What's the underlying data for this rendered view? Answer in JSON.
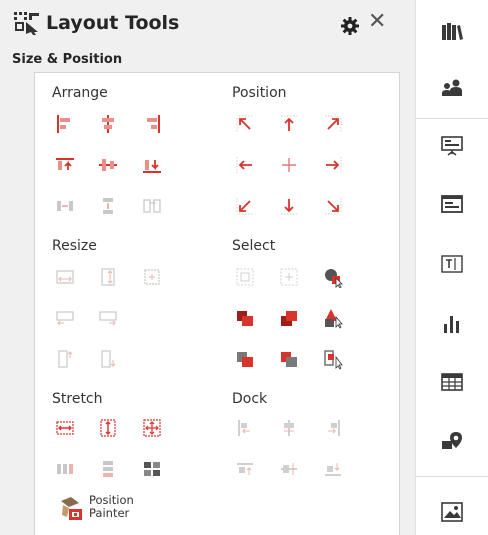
{
  "title": "Layout Tools",
  "section": "Size & Position",
  "groups": {
    "arrange": "Arrange",
    "position": "Position",
    "resize": "Resize",
    "select": "Select",
    "stretch": "Stretch",
    "dock": "Dock"
  },
  "painter": {
    "line1": "Position",
    "line2": "Painter"
  },
  "icons": {
    "app": "layout-tools-icon",
    "settings": "gear-icon",
    "close": "close-icon",
    "rail": [
      "library-icon",
      "people-icon",
      "presentation-icon",
      "dashboard-icon",
      "text-box-icon",
      "bar-chart-icon",
      "table-icon",
      "map-pin-icon",
      "image-icon"
    ]
  },
  "colors": {
    "accent": "#d9342b",
    "accent_disabled": "#efb3ae",
    "gray_disabled": "#c8c8c8",
    "rail_icon": "#3a3a3a"
  }
}
